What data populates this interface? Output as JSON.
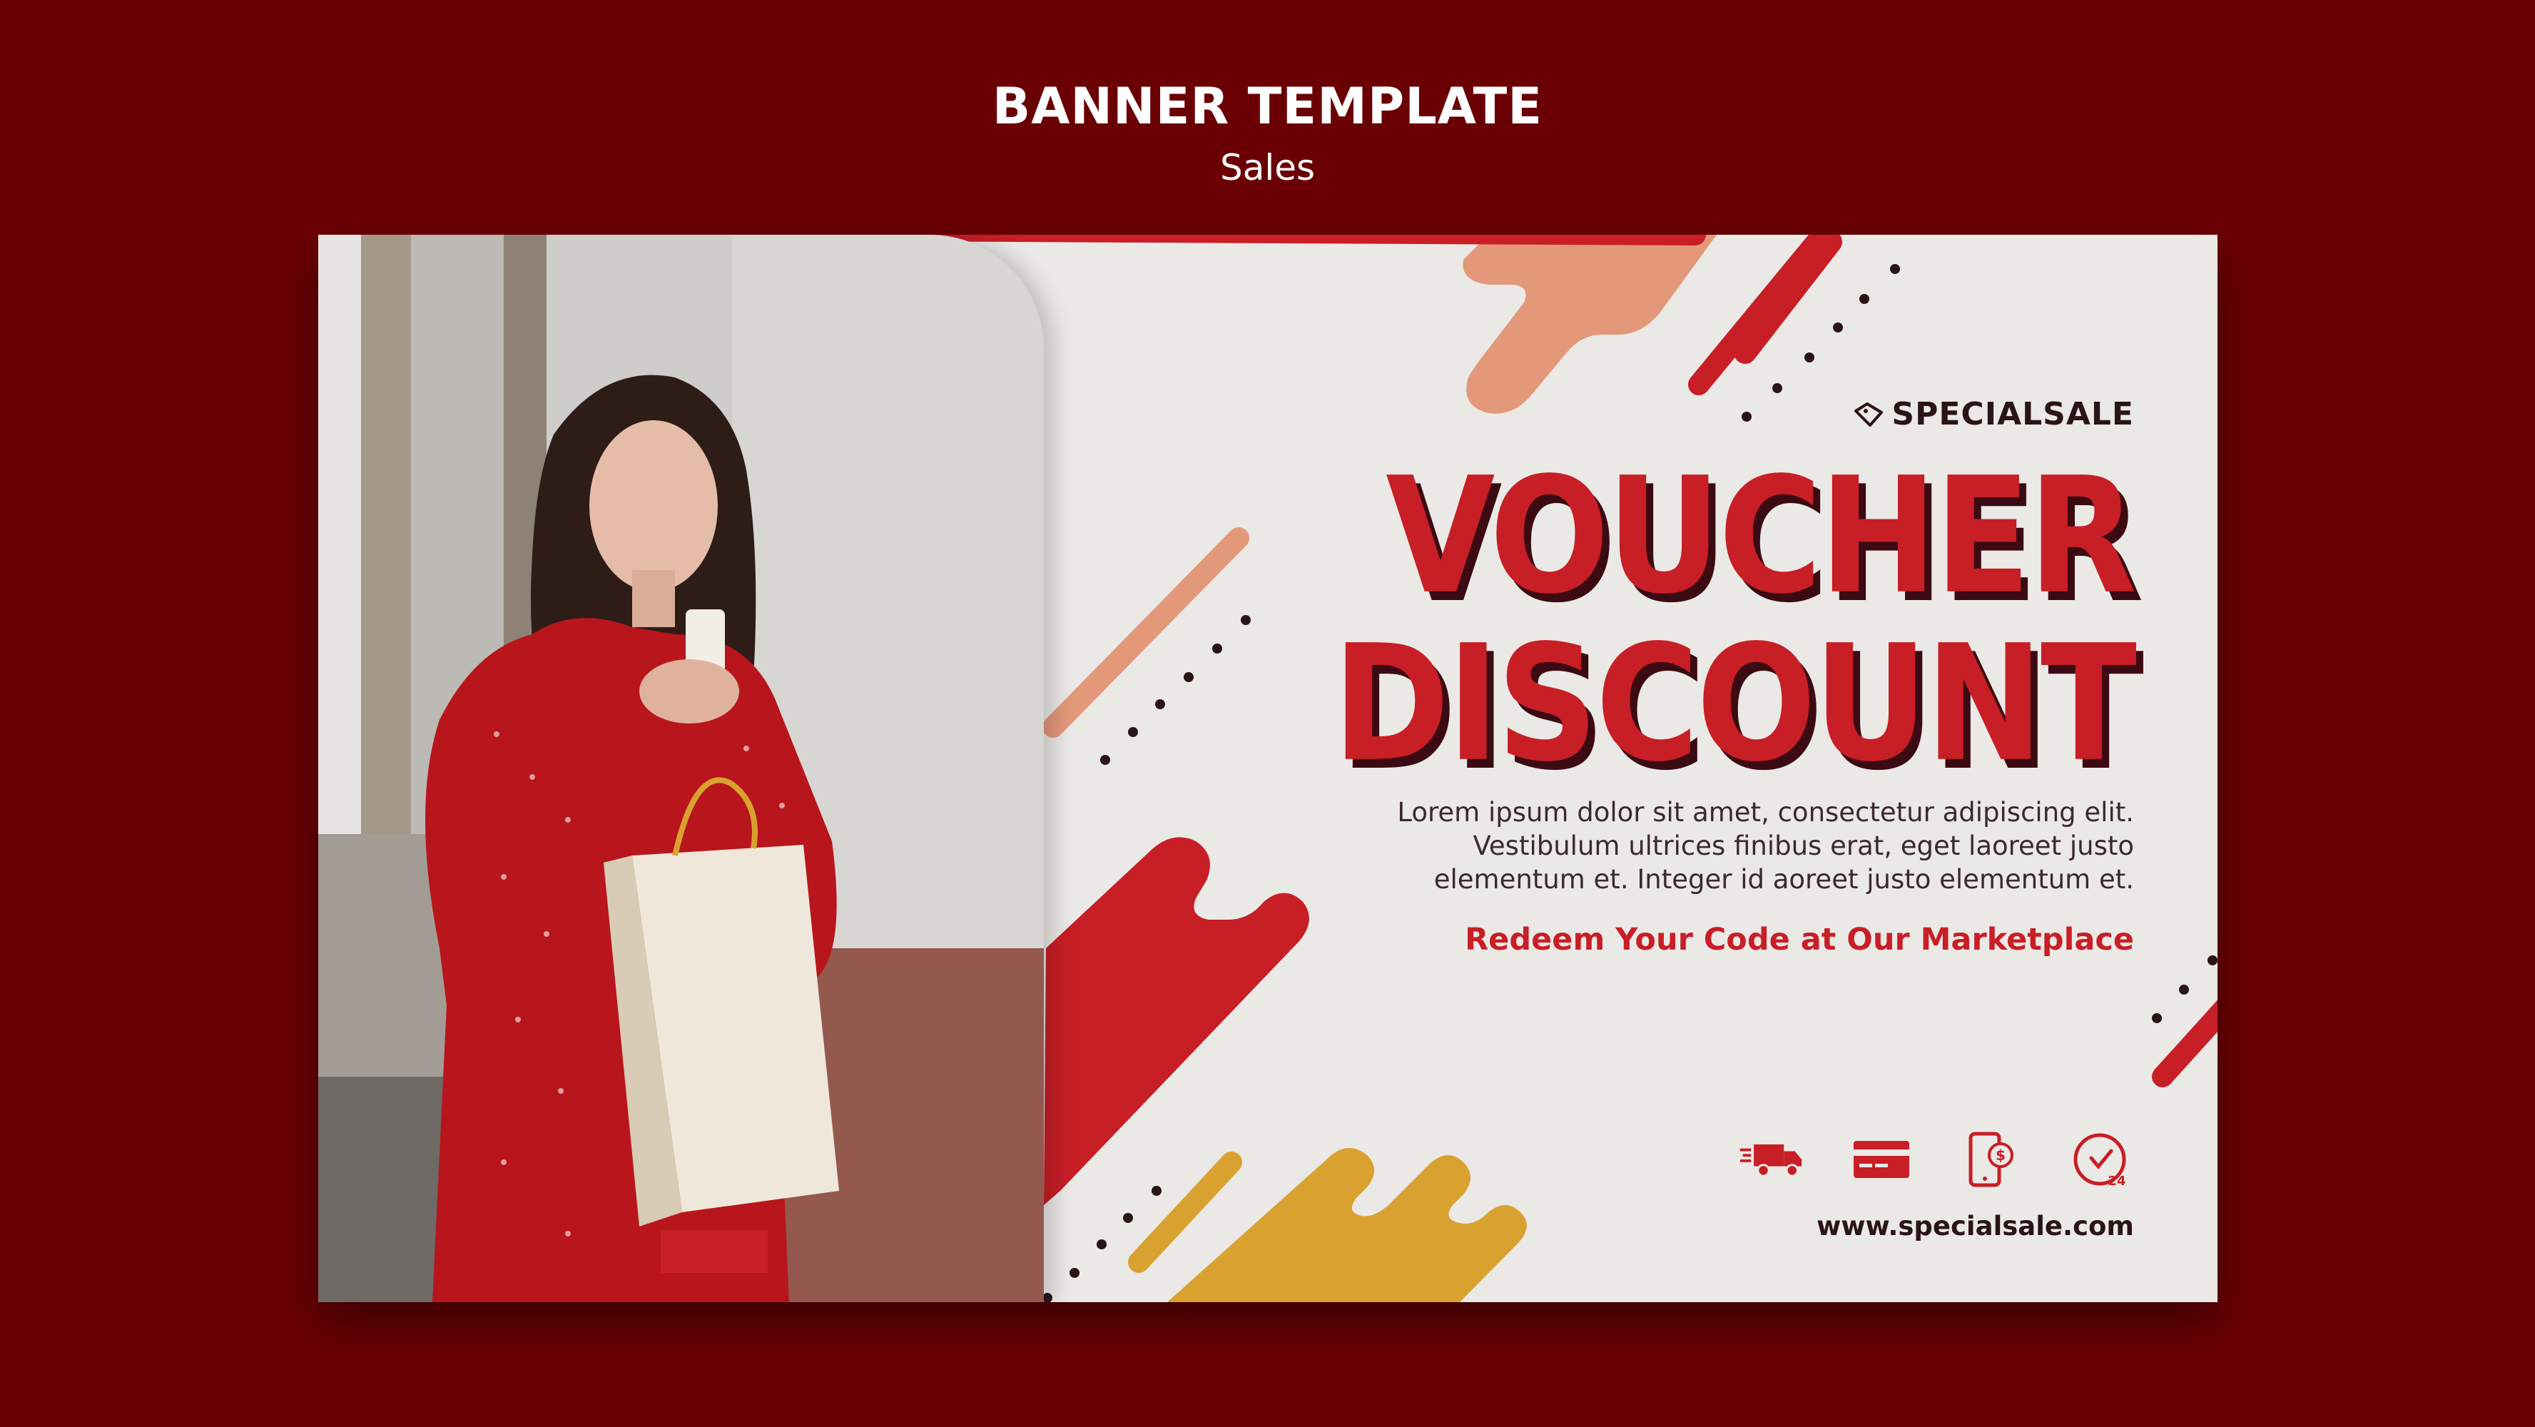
{
  "header": {
    "title": "BANNER TEMPLATE",
    "subtitle": "Sales"
  },
  "banner": {
    "brand": "SPECIALSALE",
    "headline_line1": "VOUCHER",
    "headline_line2": "DISCOUNT",
    "body": "Lorem ipsum dolor sit amet, consectetur adipiscing elit. Vestibulum ultrices finibus erat, eget laoreet justo elementum et. Integer id aoreet justo elementum et.",
    "cta": "Redeem Your Code at Our Marketplace",
    "url": "www.specialsale.com",
    "icons": [
      "delivery-truck-icon",
      "credit-card-icon",
      "mobile-payment-icon",
      "clock-24-icon"
    ]
  },
  "colors": {
    "background": "#6b0004",
    "banner": "#ebe9e6",
    "accent_red": "#c81e26",
    "accent_peach": "#e3987a",
    "accent_mustard": "#d9a12f",
    "dark": "#2a1416"
  }
}
